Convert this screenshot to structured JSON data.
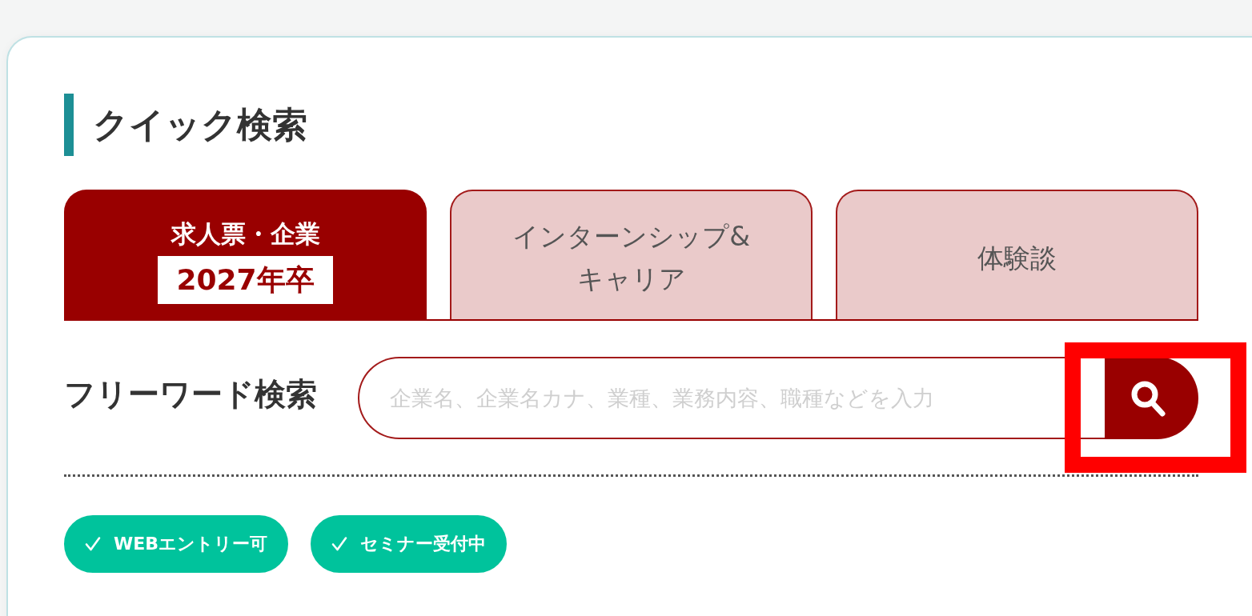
{
  "heading": "クイック検索",
  "tabs": [
    {
      "label_lines": [
        "求人票・企業"
      ],
      "badge": "2027年卒",
      "selected": true
    },
    {
      "label_lines": [
        "インターンシップ&",
        "キャリア"
      ],
      "selected": false
    },
    {
      "label_lines": [
        "体験談"
      ],
      "selected": false
    }
  ],
  "free_word_search": {
    "label": "フリーワード検索",
    "placeholder": "企業名、企業名カナ、業種、業務内容、職種などを入力"
  },
  "filters": [
    {
      "label": "WEBエントリー可",
      "checked": true
    },
    {
      "label": "セミナー受付中",
      "checked": true
    }
  ]
}
